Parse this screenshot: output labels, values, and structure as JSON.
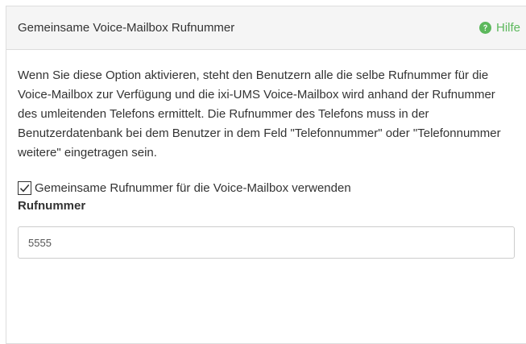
{
  "panel": {
    "title": "Gemeinsame Voice-Mailbox Rufnummer",
    "help_label": "Hilfe",
    "help_icon": "question-circle-icon",
    "accent_color": "#5cb85c"
  },
  "description": "Wenn Sie diese Option aktivieren, steht den Benutzern alle die selbe Rufnummer für die Voice-Mailbox zur Verfügung und die ixi-UMS Voice-Mailbox wird anhand der Rufnummer des umleitenden Telefons ermittelt. Die Rufnummer des Telefons muss in der Benutzerdatenbank bei dem Benutzer in dem Feld \"Telefonnummer\" oder \"Telefonnummer weitere\" eingetragen sein.",
  "checkbox": {
    "label": "Gemeinsame Rufnummer für die Voice-Mailbox verwenden",
    "checked": true
  },
  "field": {
    "label": "Rufnummer",
    "value": "5555"
  }
}
